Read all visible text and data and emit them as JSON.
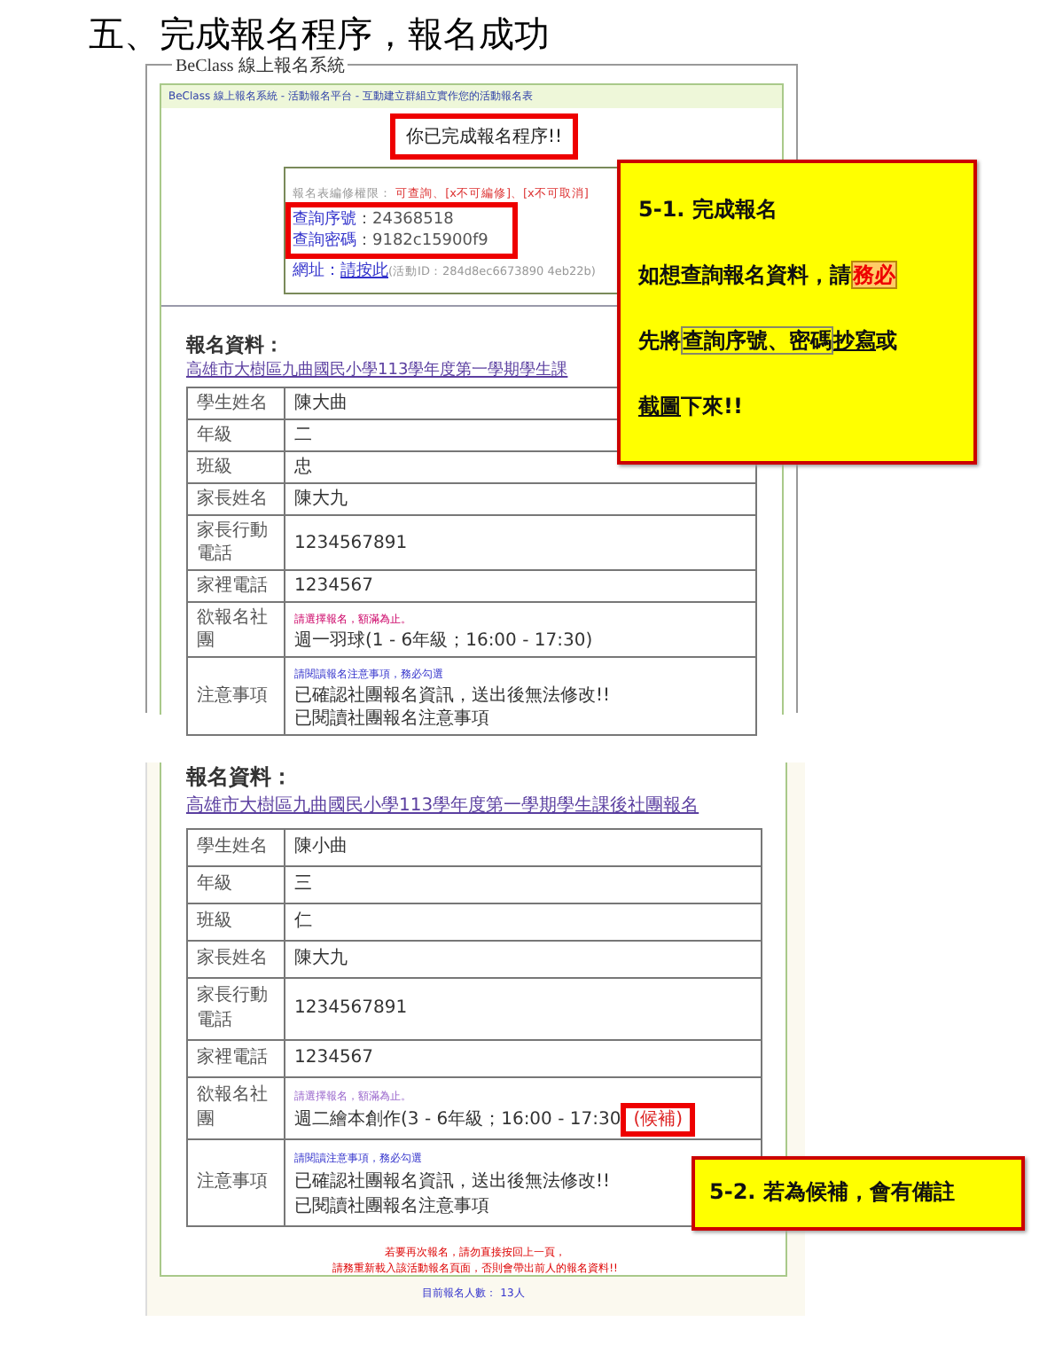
{
  "heading": "五、完成報名程序，報名成功",
  "shot1": {
    "legend": "BeClass 線上報名系統",
    "banner": "BeClass 線上報名系統 - 活動報名平台 - 互動建立群組立實作您的活動報名表",
    "done_message": {
      "text": "你已完成報名程序!!",
      "highlighted": true
    },
    "permission": {
      "label": "報名表編修權限：",
      "value": "可查詢、[x不可編修]、[x不可取消]"
    },
    "query": {
      "highlighted": true,
      "lines": [
        {
          "label": "查詢序號",
          "value": "：24368518"
        },
        {
          "label": "查詢密碼",
          "value": "：9182c15900f9"
        }
      ]
    },
    "url": {
      "label": "網址：",
      "link": "請按此",
      "note": "(活動ID：284d8ec6673890 4eb22b)"
    },
    "section_title": "報名資料：",
    "form_link": "高雄市大樹區九曲國民小學113學年度第一學期學生課",
    "rows": [
      {
        "label": "學生姓名",
        "values": [
          "陳大曲"
        ]
      },
      {
        "label": "年級",
        "values": [
          "二"
        ]
      },
      {
        "label": "班級",
        "values": [
          "忠"
        ]
      },
      {
        "label": "家長姓名",
        "values": [
          "陳大九"
        ]
      },
      {
        "label": "家長行動電話",
        "values": [
          "1234567891"
        ]
      },
      {
        "label": "家裡電話",
        "values": [
          "1234567"
        ]
      },
      {
        "label": "欲報名社團",
        "note": "請選擇報名，額滿為止。",
        "values": [
          "週一羽球(1 - 6年級；16:00 - 17:30)"
        ]
      },
      {
        "label": "注意事項",
        "note": "請閱讀報名注意事項，務必勾選",
        "values": [
          "已確認社團報名資訊，送出後無法修改!!",
          "已閱讀社團報名注意事項"
        ]
      }
    ]
  },
  "shot2": {
    "section_title": "報名資料：",
    "form_link": "高雄市大樹區九曲國民小學113學年度第一學期學生課後社團報名",
    "rows": [
      {
        "label": "學生姓名",
        "values": [
          "陳小曲"
        ]
      },
      {
        "label": "年級",
        "values": [
          "三"
        ]
      },
      {
        "label": "班級",
        "values": [
          "仁"
        ]
      },
      {
        "label": "家長姓名",
        "values": [
          "陳大九"
        ]
      },
      {
        "label": "家長行動電話",
        "values": [
          "1234567891"
        ]
      },
      {
        "label": "家裡電話",
        "values": [
          "1234567"
        ]
      },
      {
        "label": "欲報名社團",
        "note": "請選擇報名，額滿為止。",
        "values": [
          "週二繪本創作(3 - 6年級；16:00 - 17:30"
        ],
        "tag": {
          "text": "(候補)",
          "highlighted": true
        }
      },
      {
        "label": "注意事項",
        "note": "請閱讀注意事項，務必勾選",
        "values": [
          "已確認社團報名資訊，送出後無法修改!!",
          "已閱讀社團報名注意事項"
        ]
      }
    ],
    "footer_lines": [
      "若要再次報名，請勿直接按回上一頁，",
      "請務重新載入該活動報名頁面，否則會帶出前人的報名資料!!"
    ],
    "count": "目前報名人數： 13人"
  },
  "callouts": [
    {
      "title": "5-1. 完成報名",
      "lines": [
        [
          {
            "kind": "plain",
            "text": "如想查詢報名資料，請"
          },
          {
            "kind": "warn",
            "text": "務必"
          }
        ],
        [
          {
            "kind": "plain",
            "text": "先將"
          },
          {
            "kind": "boxed",
            "text": "查詢序號、密碼"
          },
          {
            "kind": "underline",
            "text": "抄寫"
          },
          {
            "kind": "plain",
            "text": "或"
          }
        ],
        [
          {
            "kind": "underline",
            "text": "截圖"
          },
          {
            "kind": "plain",
            "text": "下來!!"
          }
        ]
      ]
    },
    {
      "title": "5-2. 若為候補，會有備註"
    }
  ]
}
